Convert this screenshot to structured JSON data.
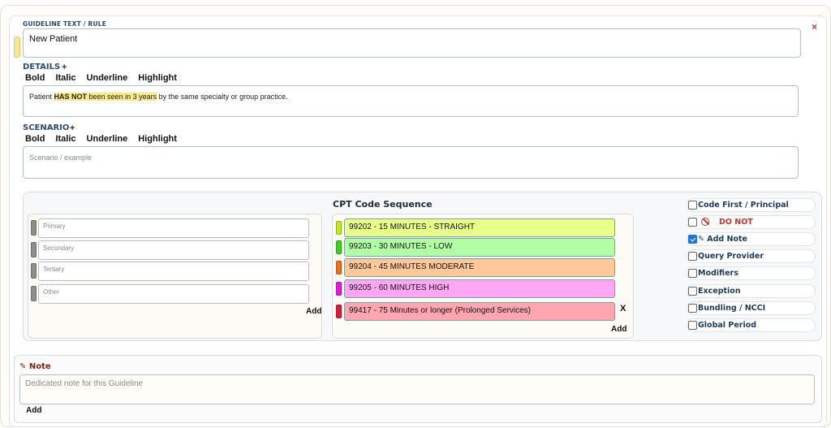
{
  "guideline": {
    "label": "GUIDELINE TEXT / RULE",
    "value": "New Patient",
    "close_glyph": "×"
  },
  "details": {
    "label": "DETAILS",
    "plus": "+",
    "toolbar": [
      "Bold",
      "Italic",
      "Underline",
      "Highlight"
    ],
    "text_before": "Patient ",
    "text_bold": "HAS NOT",
    "text_highlight": " been seen in 3 years",
    "text_after": " by the same specialty or group practice."
  },
  "scenario": {
    "label": "SCENARIO",
    "plus": "+",
    "toolbar": [
      "Bold",
      "Italic",
      "Underline",
      "Highlight"
    ],
    "placeholder": "Scenario / example"
  },
  "diagnosis": {
    "placeholders": [
      "Primary",
      "Secondary",
      "Tertiary",
      "Other"
    ],
    "add_label": "Add"
  },
  "cpt": {
    "title": "CPT Code Sequence",
    "add_label": "Add",
    "remove_label": "X",
    "codes": [
      {
        "label": "99202 - 15 MINUTES - STRAIGHT",
        "color": "#e8ff8a",
        "grip": "#c8e81a"
      },
      {
        "label": "99203 - 30 MINUTES - LOW",
        "color": "#b3ffa6",
        "grip": "#3cd11a"
      },
      {
        "label": "99204 - 45 MINUTES MODERATE",
        "color": "#ffc89a",
        "grip": "#f0701a"
      },
      {
        "label": "99205 - 60 MINUTES HIGH",
        "color": "#ffa6f5",
        "grip": "#e41ad8"
      },
      {
        "label": "99417 - 75 Minutes or longer (Prolonged Services)",
        "color": "#ffa6b0",
        "grip": "#e01a34"
      }
    ]
  },
  "options": [
    {
      "label": "Code First / Principal",
      "checked": false
    },
    {
      "label": "DO NOT",
      "checked": false,
      "icon": "ban-icon"
    },
    {
      "label": "✎ Add Note",
      "checked": true
    },
    {
      "label": "Query Provider",
      "checked": false
    },
    {
      "label": "Modifiers",
      "checked": false
    },
    {
      "label": "Exception",
      "checked": false
    },
    {
      "label": "Bundling / NCCI",
      "checked": false
    },
    {
      "label": "Global Period",
      "checked": false
    }
  ],
  "note": {
    "label": "✎ Note",
    "placeholder": "Dedicated note for this Guideline",
    "add_label": "Add"
  }
}
